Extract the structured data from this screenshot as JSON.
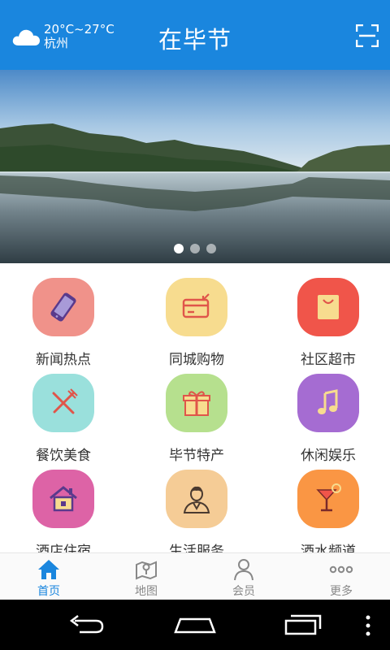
{
  "header": {
    "weather_icon": "cloud-icon",
    "temperature": "20°C~27°C",
    "city": "杭州",
    "title": "在毕节",
    "scan_icon": "scan-icon"
  },
  "banner": {
    "slide_count": 3,
    "active_slide": 1
  },
  "grid": {
    "items": [
      {
        "label": "新闻热点",
        "icon": "phone-icon",
        "color": "#f0928a"
      },
      {
        "label": "同城购物",
        "icon": "card-icon",
        "color": "#f7dc8f"
      },
      {
        "label": "社区超市",
        "icon": "shopping-bag-icon",
        "color": "#f0554a"
      },
      {
        "label": "餐饮美食",
        "icon": "fork-knife-icon",
        "color": "#9ae0dc"
      },
      {
        "label": "毕节特产",
        "icon": "gift-icon",
        "color": "#b6e08e"
      },
      {
        "label": "休闲娱乐",
        "icon": "music-note-icon",
        "color": "#a56cd2"
      },
      {
        "label": "酒店住宿",
        "icon": "house-icon",
        "color": "#dd63a6"
      },
      {
        "label": "生活服务",
        "icon": "person-icon",
        "color": "#f5cc96"
      },
      {
        "label": "酒水频道",
        "icon": "cocktail-icon",
        "color": "#fa9644"
      }
    ]
  },
  "tabbar": {
    "tabs": [
      {
        "label": "首页",
        "icon": "home-icon",
        "active": true
      },
      {
        "label": "地图",
        "icon": "map-icon",
        "active": false
      },
      {
        "label": "会员",
        "icon": "user-icon",
        "active": false
      },
      {
        "label": "更多",
        "icon": "more-icon",
        "active": false
      }
    ],
    "active_color": "#1a86de"
  },
  "colors": {
    "header_bg": "#1a86de"
  }
}
